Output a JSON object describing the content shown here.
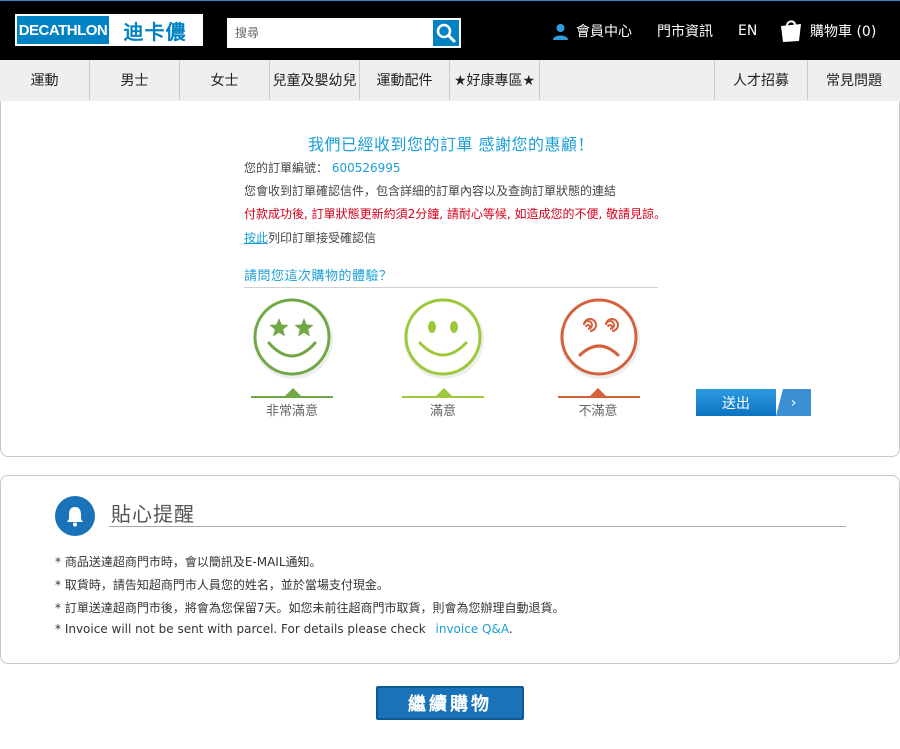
{
  "header": {
    "logo_left": "DECATHLON",
    "logo_right": "迪卡儂",
    "search_placeholder": "搜尋",
    "member_label": "會員中心",
    "store_label": "門市資訊",
    "lang_label": "EN",
    "cart_label": "購物車 (0)"
  },
  "nav": {
    "items": [
      "運動",
      "男士",
      "女士",
      "兒童及嬰幼兒",
      "運動配件",
      "★好康專區★"
    ],
    "right_items": [
      "人才招募",
      "常見問題"
    ]
  },
  "order": {
    "thanks": "我們已經收到您的訂單 感謝您的惠顧！",
    "number_label": "您的訂單編號：",
    "number": "600526995",
    "email_note": "您會收到訂單確認信件，包含詳細的訂單內容以及查詢訂單狀態的連結",
    "payment_note": "付款成功後, 訂單狀態更新約須2分鐘, 請耐心等候, 如造成您的不便, 敬請見諒。",
    "print_link": "按此",
    "print_text": "列印訂單接受確認信"
  },
  "survey": {
    "title": "請問您這次購物的體驗？",
    "options": [
      "非常滿意",
      "滿意",
      "不滿意"
    ],
    "submit_label": "送出",
    "colors": {
      "very_happy": "#6fa845",
      "happy": "#9dc83a",
      "unhappy": "#d4613c"
    }
  },
  "tips": {
    "title": "貼心提醒",
    "items": [
      "* 商品送達超商門市時，會以簡訊及E-MAIL通知。",
      "* 取貨時，請告知超商門市人員您的姓名，並於當場支付現金。",
      "* 訂單送達超商門市後，將會為您保留7天。如您未前往超商門市取貨，則會為您辦理自動退貨。"
    ],
    "invoice_text": "* Invoice will not be sent with parcel. For details please check",
    "invoice_link": "invoice Q&A",
    "invoice_end": "."
  },
  "continue_label": "繼續購物"
}
